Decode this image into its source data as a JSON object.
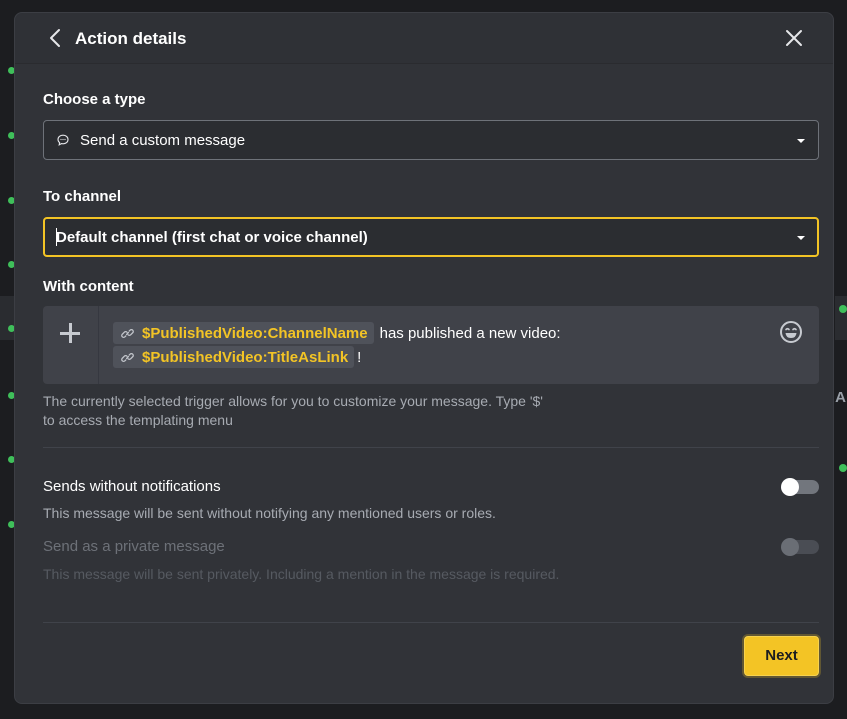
{
  "colors": {
    "accent": "#f3c425",
    "modal_bg": "#313338",
    "input_bg": "#2b2d31",
    "editor_bg": "#404249",
    "text_primary": "#ffffff",
    "text_secondary": "#a7abb2",
    "text_disabled": "#5c6068",
    "status_online": "#3fbf5a"
  },
  "header": {
    "title": "Action details",
    "back_icon": "chevron-left-icon",
    "close_icon": "close-icon"
  },
  "type_section": {
    "label": "Choose a type",
    "selected": "Send a custom message",
    "icon": "chat-bubble-icon"
  },
  "channel_section": {
    "label": "To channel",
    "selected": "Default channel (first chat or voice channel)"
  },
  "content_section": {
    "label": "With content",
    "add_icon": "plus-icon",
    "emoji_icon": "emoji-icon",
    "variable_1": "$PublishedVideo:ChannelName",
    "text_1": "has published a new video:",
    "variable_2": "$PublishedVideo:TitleAsLink",
    "text_2": "!",
    "helper_line_1": "The currently selected trigger allows for you to customize your message. Type '$'",
    "helper_line_2": "to access the templating menu"
  },
  "options": [
    {
      "title": "Sends without notifications",
      "description": "This message will be sent without notifying any mentioned users or roles.",
      "enabled": true,
      "on": false
    },
    {
      "title": "Send as a private message",
      "description": "This message will be sent privately. Including a mention in the message is required.",
      "enabled": false,
      "on": false
    }
  ],
  "footer": {
    "next_label": "Next"
  }
}
